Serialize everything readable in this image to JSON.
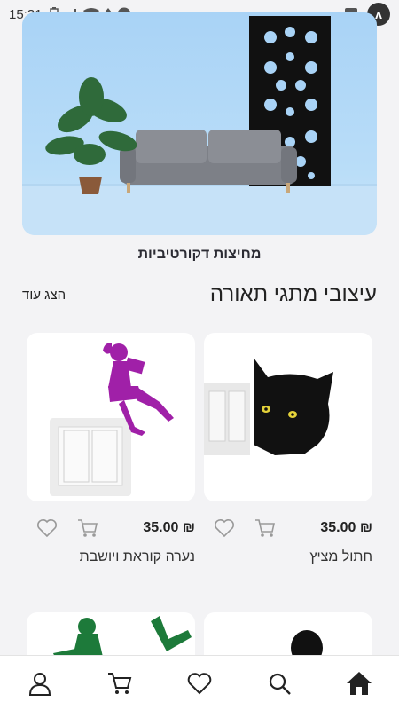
{
  "status": {
    "time": "15:31"
  },
  "banner": {
    "caption": "מחיצות דקורטיביות"
  },
  "section": {
    "title": "עיצובי מתגי תאורה",
    "show_more": "הצג עוד"
  },
  "products": [
    {
      "name": "חתול מציץ",
      "price": "35.00 ₪"
    },
    {
      "name": "נערה קוראת ויושבת",
      "price": "35.00 ₪"
    }
  ],
  "colors": {
    "accent": "#111111",
    "girl": "#a020a8",
    "green": "#1d7a3a"
  }
}
